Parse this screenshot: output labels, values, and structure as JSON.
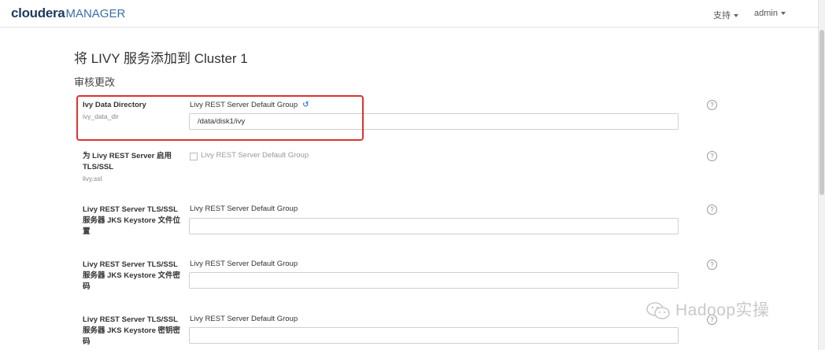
{
  "header": {
    "logo_brand": "cloudera",
    "logo_product": "MANAGER",
    "support_label": "支持",
    "user_label": "admin"
  },
  "page": {
    "title": "将 LIVY 服务添加到 Cluster 1",
    "step": "审核更改"
  },
  "properties": [
    {
      "name": "Ivy Data Directory",
      "key": "ivy_data_dir",
      "group": "Livy REST Server Default Group",
      "value": "/data/disk1/ivy"
    },
    {
      "name": "为 Livy REST Server 启用 TLS/SSL",
      "key": "livy.ssl",
      "group": "Livy REST Server Default Group",
      "checked": false
    },
    {
      "name": "Livy REST Server TLS/SSL 服务器 JKS Keystore 文件位置",
      "group": "Livy REST Server Default Group",
      "value": ""
    },
    {
      "name": "Livy REST Server TLS/SSL 服务器 JKS Keystore 文件密码",
      "group": "Livy REST Server Default Group",
      "value": ""
    },
    {
      "name": "Livy REST Server TLS/SSL 服务器 JKS Keystore 密钥密码",
      "group": "Livy REST Server Default Group",
      "value": ""
    }
  ],
  "icons": {
    "help": "question-circle-icon",
    "revert": "undo-icon",
    "dropdown": "caret-down-icon"
  },
  "colors": {
    "brand": "#1f3a5f",
    "product": "#3b6ea8",
    "highlight": "#d9332f",
    "revert_icon": "#3b7ed0"
  },
  "watermark": {
    "text": "Hadoop实操"
  }
}
